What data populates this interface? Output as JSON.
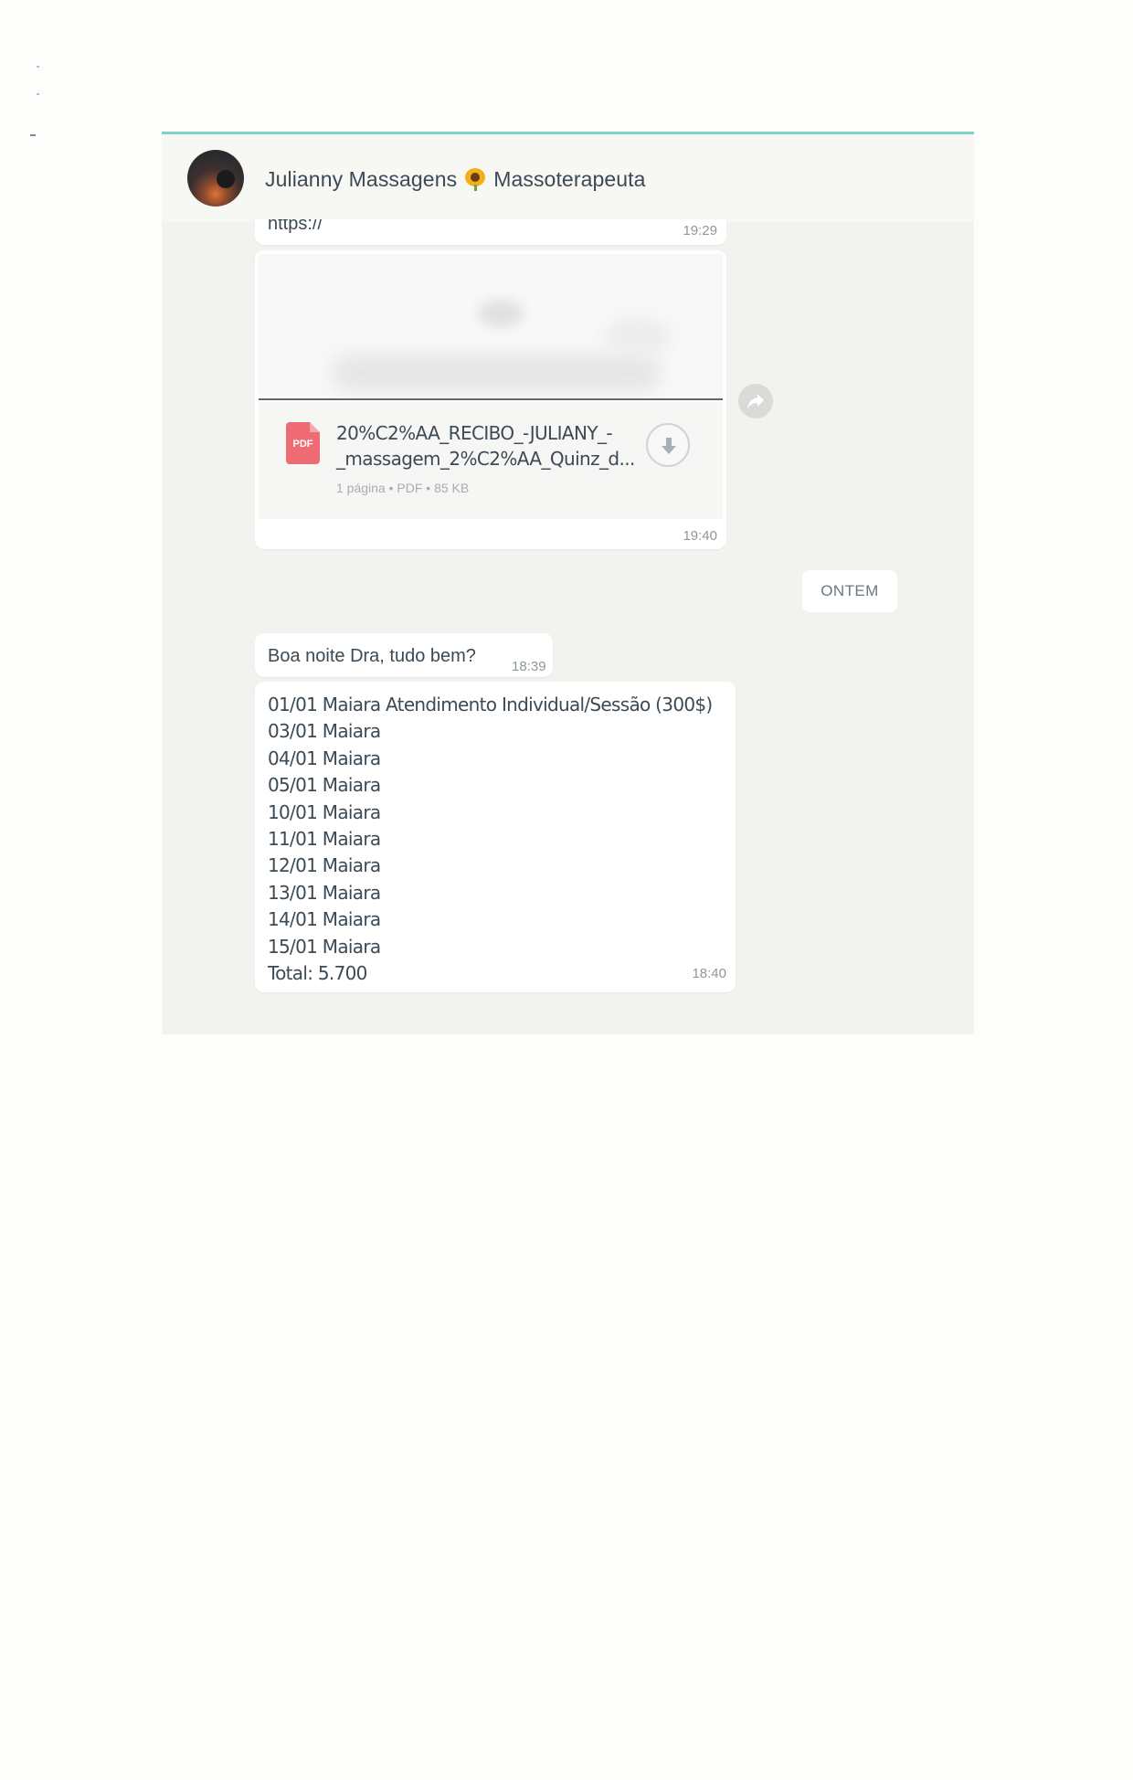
{
  "header": {
    "contact_name_part1": "Julianny Massagens",
    "contact_name_part2": "Massoterapeuta",
    "emoji_icon": "sunflower-icon"
  },
  "messages": {
    "top_partial": {
      "text": "https://",
      "time": "19:29"
    },
    "document": {
      "file_name": "20%C2%AA_RECIBO_-JULIANY_-_massagem_2%C2%AA_Quinz_d...",
      "meta": "1 página • PDF • 85 KB",
      "icon_label": "PDF",
      "time": "19:40"
    },
    "date_divider": "ONTEM",
    "greeting": {
      "text": "Boa noite Dra, tudo bem?",
      "time": "18:39"
    },
    "list_message": {
      "lines": [
        "01/01 Maiara Atendimento Individual/Sessão (300$)",
        "03/01 Maiara",
        "04/01 Maiara",
        "05/01 Maiara",
        "10/01 Maiara",
        "11/01 Maiara",
        "12/01 Maiara",
        "13/01 Maiara",
        "14/01 Maiara",
        "15/01 Maiara",
        "Total: 5.700"
      ],
      "time": "18:40"
    }
  },
  "colors": {
    "chat_background": "#f2f2ee",
    "header_border": "#7fd1c3",
    "bubble": "#ffffff",
    "pdf_icon": "#ee6b73"
  }
}
